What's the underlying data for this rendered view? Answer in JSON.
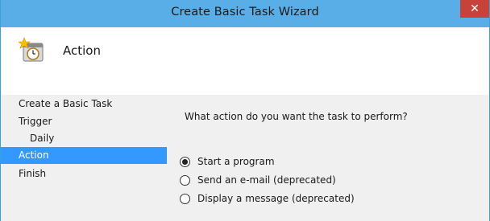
{
  "window": {
    "title": "Create Basic Task Wizard",
    "close_label": "✕"
  },
  "header": {
    "title": "Action",
    "icon": "task-clock-icon"
  },
  "sidebar": {
    "items": [
      {
        "label": "Create a Basic Task",
        "selected": false
      },
      {
        "label": "Trigger",
        "selected": false
      },
      {
        "label": "Daily",
        "selected": false
      },
      {
        "label": "Action",
        "selected": true
      },
      {
        "label": "Finish",
        "selected": false
      }
    ]
  },
  "content": {
    "question": "What action do you want the task to perform?",
    "options": [
      {
        "label": "Start a program",
        "checked": true
      },
      {
        "label": "Send an e-mail (deprecated)",
        "checked": false
      },
      {
        "label": "Display a message (deprecated)",
        "checked": false
      }
    ]
  },
  "colors": {
    "titlebar": "#5aaee8",
    "close_button": "#c7433a",
    "selection": "#3399ff"
  }
}
